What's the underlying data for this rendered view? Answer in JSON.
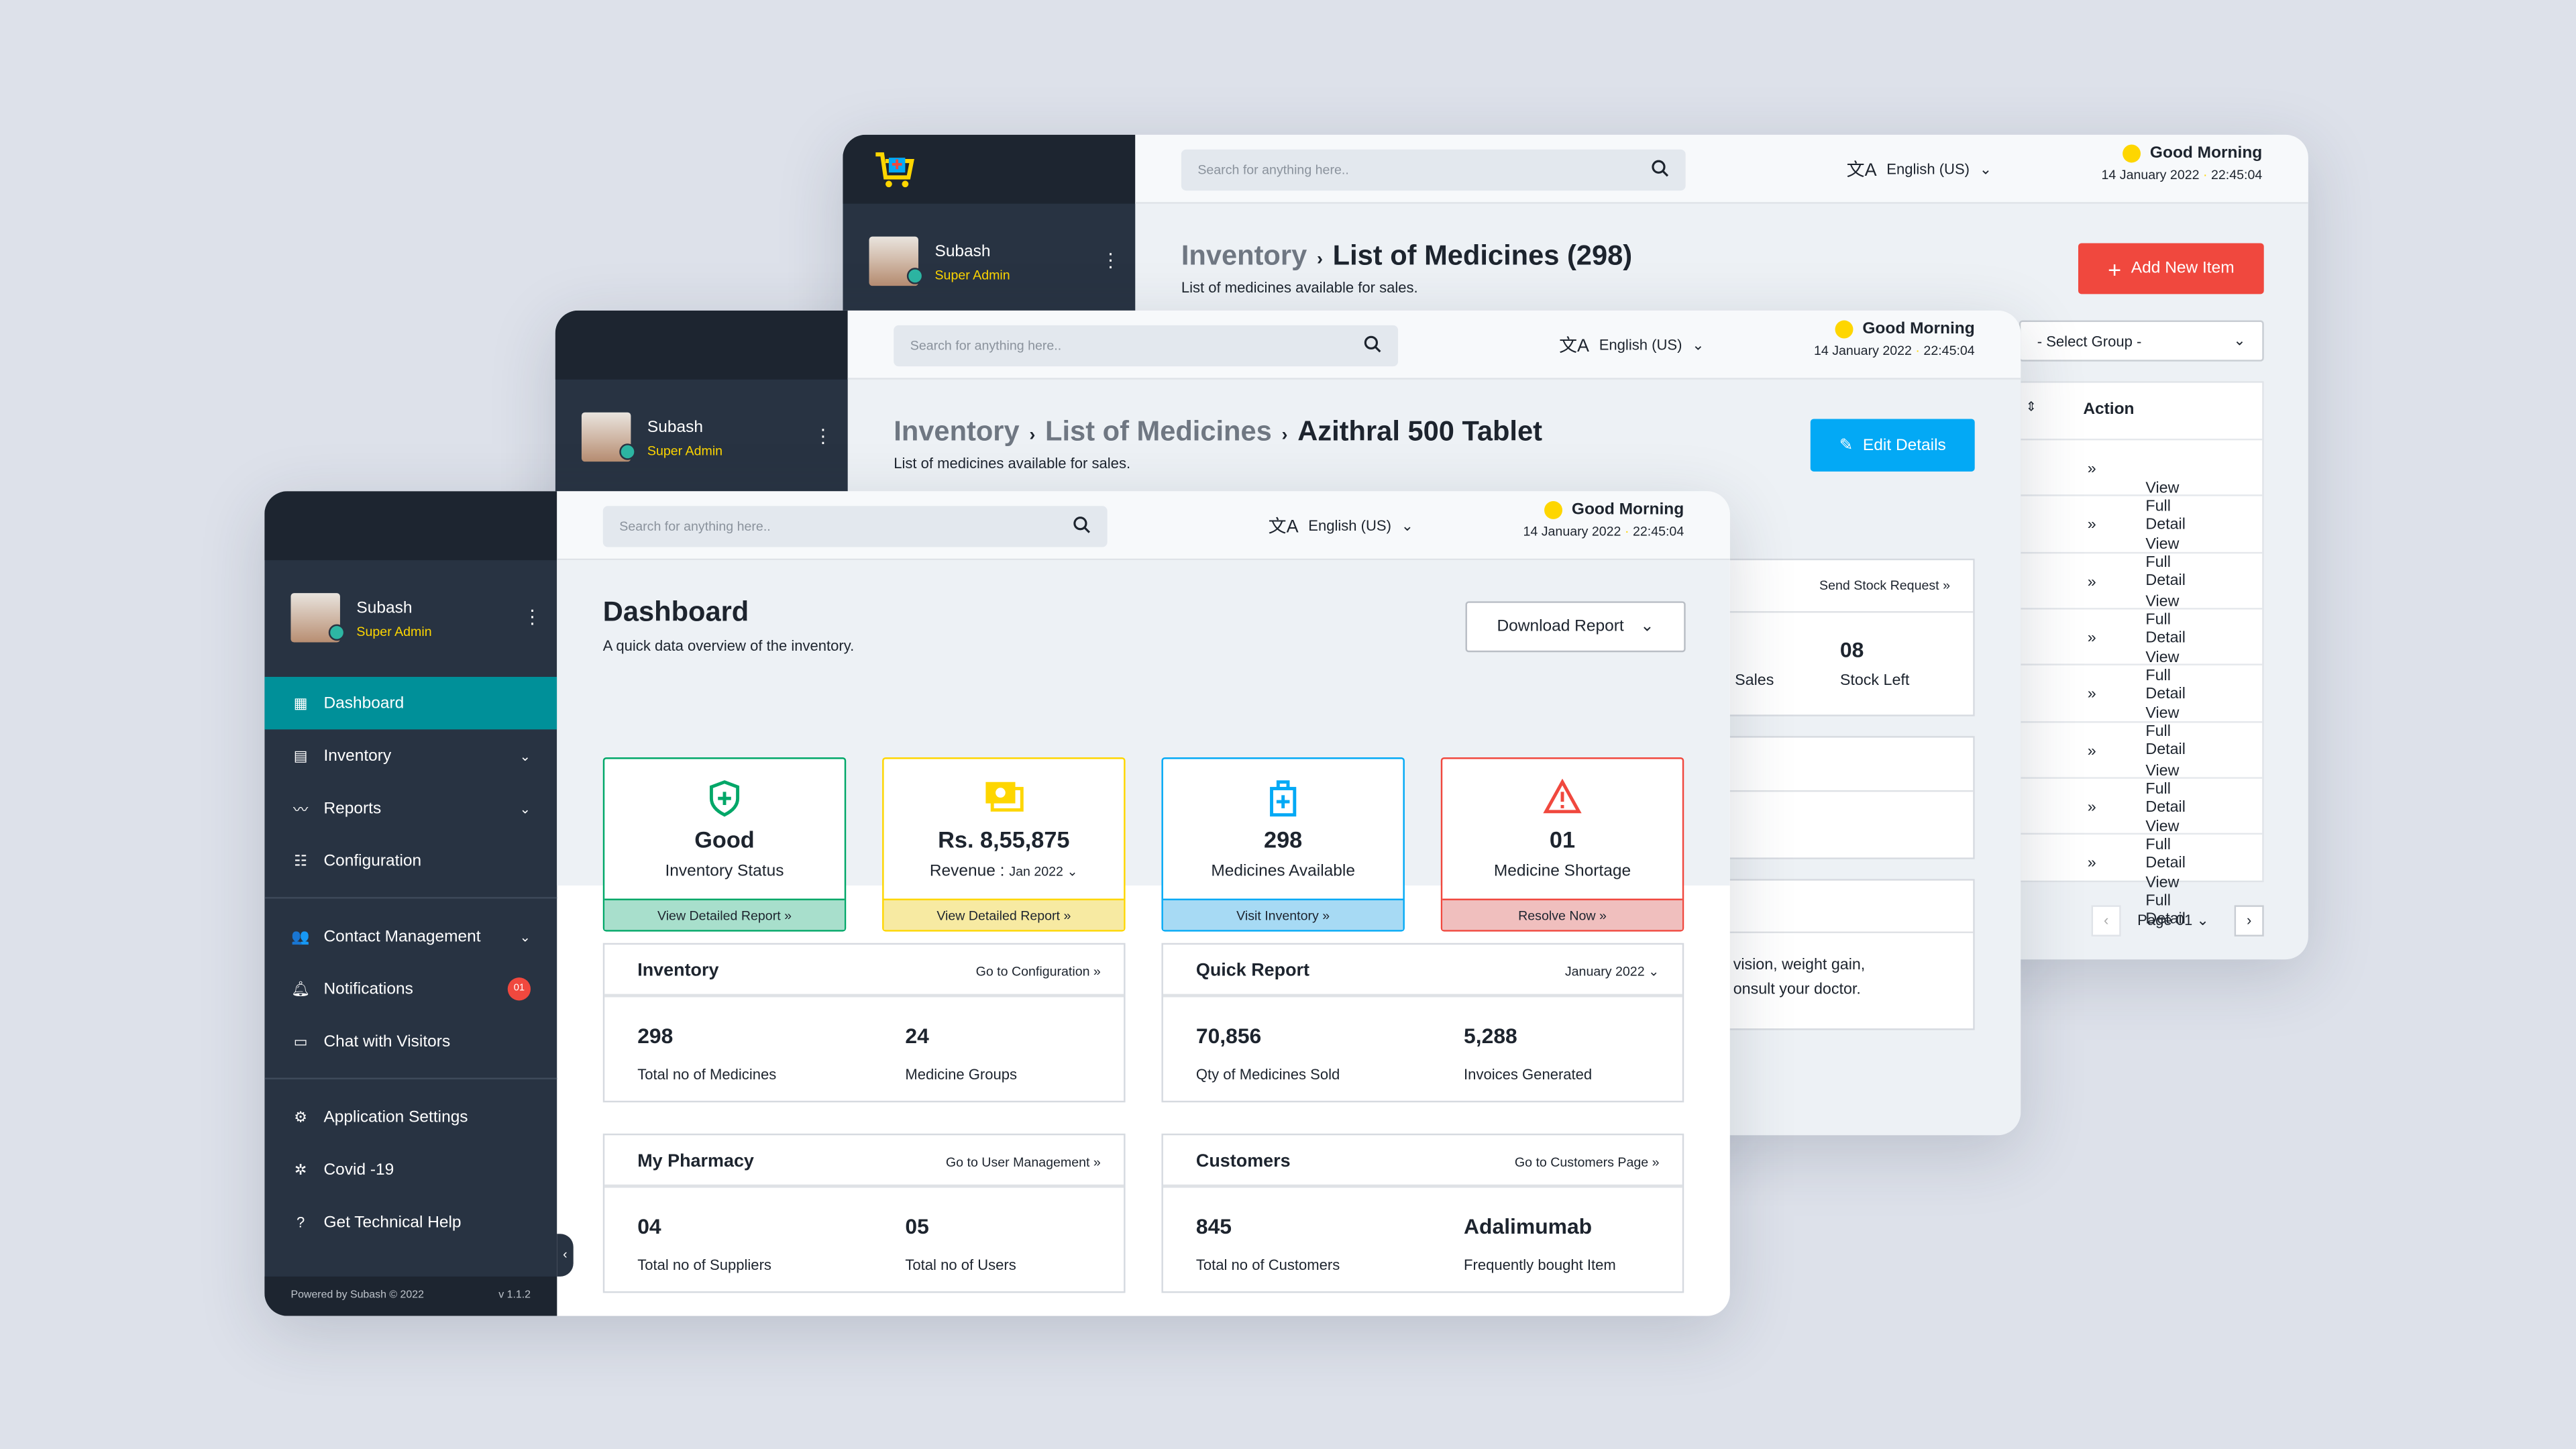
{
  "common": {
    "search_placeholder": "Search for anything here..",
    "language": "English (US)",
    "greeting": "Good Morning",
    "date": "14 January 2022",
    "time": "22:45:04",
    "user_name": "Subash",
    "user_role": "Super Admin",
    "colors": {
      "sidebar": "#283342",
      "accent_teal": "#009099",
      "accent_yellow": "#fed600",
      "danger": "#f0483e",
      "info": "#03a9f5"
    }
  },
  "back_window": {
    "breadcrumb": [
      "Inventory",
      "List of Medicines (298)"
    ],
    "subtitle": "List of medicines available for sales.",
    "add_button": "Add New Item",
    "select_group": "- Select Group -",
    "table_header": "Action",
    "rows": [
      "View Full Detail",
      "View Full Detail",
      "View Full Detail",
      "View Full Detail",
      "View Full Detail",
      "View Full Detail",
      "View Full Detail",
      "View Full Detail"
    ],
    "page_label": "Page 01"
  },
  "middle_window": {
    "breadcrumb": [
      "Inventory",
      "List of Medicines",
      "Azithral 500 Tablet"
    ],
    "subtitle": "List of medicines available for sales.",
    "edit_button": "Edit Details",
    "send_stock": "Send Stock Request",
    "sales_label": "Sales",
    "stock_value": "08",
    "stock_label": "Stock Left",
    "side_effects_line1": "vision, weight gain,",
    "side_effects_line2": "onsult your doctor."
  },
  "sidebar": {
    "items": [
      {
        "label": "Dashboard",
        "icon": "dashboard-icon",
        "active": true
      },
      {
        "label": "Inventory",
        "icon": "inventory-icon",
        "chevron": true
      },
      {
        "label": "Reports",
        "icon": "reports-icon",
        "chevron": true
      },
      {
        "label": "Configuration",
        "icon": "configuration-icon"
      },
      {
        "label": "Contact Management",
        "icon": "contacts-icon",
        "chevron": true
      },
      {
        "label": "Notifications",
        "icon": "bell-icon",
        "badge": "01"
      },
      {
        "label": "Chat with Visitors",
        "icon": "chat-icon"
      },
      {
        "label": "Application Settings",
        "icon": "gear-icon"
      },
      {
        "label": "Covid -19",
        "icon": "virus-icon"
      },
      {
        "label": "Get Technical Help",
        "icon": "help-icon"
      }
    ],
    "footer": "Powered by Subash © 2022",
    "version": "v 1.1.2"
  },
  "dashboard": {
    "title": "Dashboard",
    "subtitle": "A quick data overview of the inventory.",
    "download_button": "Download Report",
    "cards": [
      {
        "value": "Good",
        "label": "Inventory Status",
        "link": "View Detailed Report",
        "color": "#01a768"
      },
      {
        "value": "Rs. 8,55,875",
        "label": "Revenue :",
        "period": "Jan 2022",
        "link": "View Detailed Report",
        "color": "#fed600"
      },
      {
        "value": "298",
        "label": "Medicines Available",
        "link": "Visit Inventory",
        "color": "#03a9f5"
      },
      {
        "value": "01",
        "label": "Medicine Shortage",
        "link": "Resolve Now",
        "color": "#f0483e"
      }
    ],
    "panels": [
      {
        "title": "Inventory",
        "link": "Go to Configuration",
        "stats": [
          {
            "value": "298",
            "label": "Total no of Medicines"
          },
          {
            "value": "24",
            "label": "Medicine Groups"
          }
        ]
      },
      {
        "title": "Quick Report",
        "link": "January 2022",
        "stats": [
          {
            "value": "70,856",
            "label": "Qty of Medicines Sold"
          },
          {
            "value": "5,288",
            "label": "Invoices Generated"
          }
        ]
      },
      {
        "title": "My Pharmacy",
        "link": "Go to User Management",
        "stats": [
          {
            "value": "04",
            "label": "Total no of Suppliers"
          },
          {
            "value": "05",
            "label": "Total no of Users"
          }
        ]
      },
      {
        "title": "Customers",
        "link": "Go to Customers Page",
        "stats": [
          {
            "value": "845",
            "label": "Total no of Customers"
          },
          {
            "value": "Adalimumab",
            "label": "Frequently bought Item"
          }
        ]
      }
    ]
  }
}
